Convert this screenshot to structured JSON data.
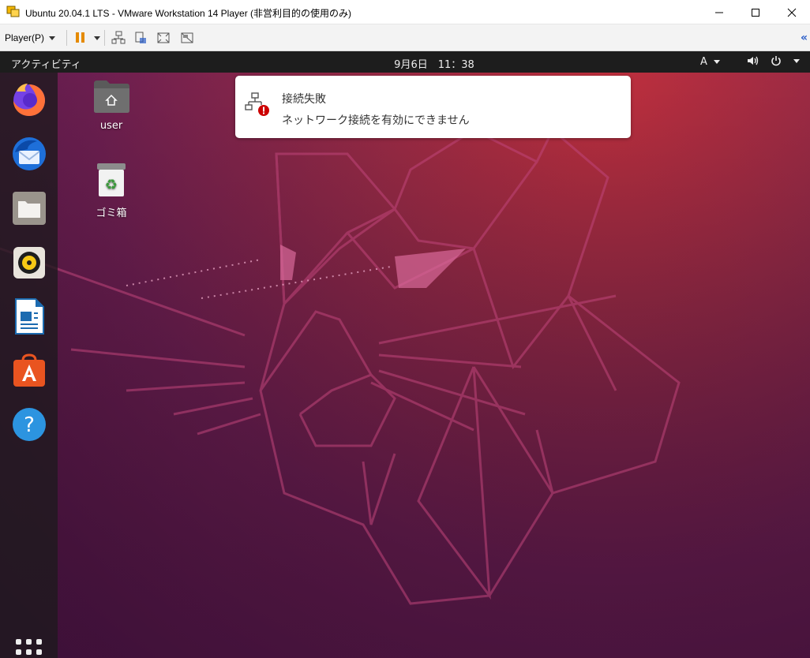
{
  "window": {
    "title": "Ubuntu 20.04.1 LTS - VMware Workstation 14 Player (非営利目的の使用のみ)"
  },
  "toolbar": {
    "player_menu": "Player(P)"
  },
  "ubuntu": {
    "topbar": {
      "activities": "アクティビティ",
      "clock": "9月6日　11：38",
      "input_method": "A"
    },
    "desktop_icons": [
      {
        "label": "user",
        "icon": "home-folder-icon"
      },
      {
        "label": "ゴミ箱",
        "icon": "trash-icon"
      }
    ],
    "dock_items": [
      {
        "name": "firefox",
        "icon": "firefox-icon"
      },
      {
        "name": "thunderbird",
        "icon": "thunderbird-icon"
      },
      {
        "name": "files",
        "icon": "files-icon"
      },
      {
        "name": "rhythmbox",
        "icon": "rhythmbox-icon"
      },
      {
        "name": "libreoffice-writer",
        "icon": "writer-icon"
      },
      {
        "name": "ubuntu-software",
        "icon": "software-icon"
      },
      {
        "name": "help",
        "icon": "help-icon"
      }
    ],
    "notification": {
      "title": "接続失敗",
      "body": "ネットワーク接続を有効にできません"
    }
  },
  "colors": {
    "accent": "#e95420",
    "topbar": "#1d1d1d",
    "error": "#cc0000"
  }
}
